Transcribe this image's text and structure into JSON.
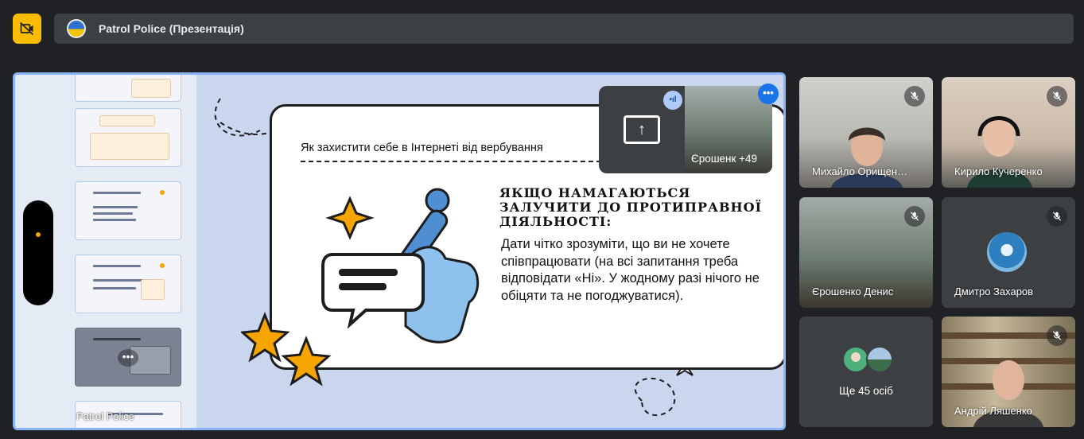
{
  "meeting": {
    "title": "Patrol Police (Презентація)"
  },
  "stage": {
    "presenter_label": "Patrol Police",
    "thumb_more_glyph": "•••"
  },
  "slide": {
    "subtitle": "Як захистити себе в Інтернеті від вербування",
    "heading": "ЯКЩО НАМАГАЮТЬСЯ ЗАЛУЧИТИ ДО ПРОТИПРАВНОЇ ДІЯЛЬНОСТІ:",
    "body": "Дати чітко зрозуміти, що ви не хочете співпрацювати (на всі запитання треба відповідати «Ні». У жодному разі нічого не обіцяти та не погоджуватися)."
  },
  "self_view": {
    "name": "Єрошенк +49"
  },
  "participants": [
    {
      "name": "Михайло Орищен…",
      "muted": true
    },
    {
      "name": "Кирило Кучеренко",
      "muted": true
    },
    {
      "name": "Єрошенко Денис",
      "muted": true
    },
    {
      "name": "Дмитро Захаров",
      "muted": true
    },
    {
      "name": "Ще 45 осіб",
      "muted": false
    },
    {
      "name": "Андрій Ляшенко",
      "muted": true
    }
  ],
  "colors": {
    "accent_blue": "#8ab4f8",
    "cam_off_yellow": "#fbbc04",
    "panel": "#3c4043",
    "background": "#202124"
  }
}
